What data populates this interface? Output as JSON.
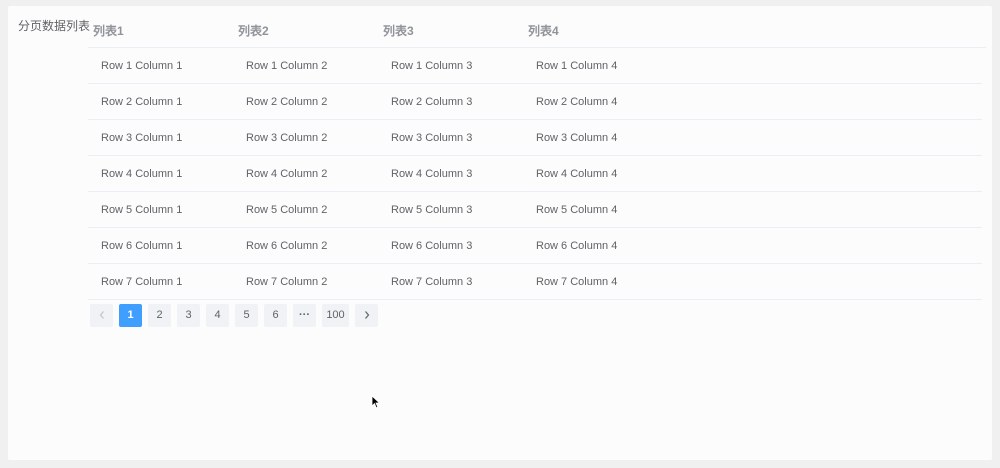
{
  "panel": {
    "label": "分页数据列表"
  },
  "table": {
    "headers": [
      "列表1",
      "列表2",
      "列表3",
      "列表4"
    ],
    "rows": [
      [
        "Row 1 Column 1",
        "Row 1 Column 2",
        "Row 1 Column 3",
        "Row 1 Column 4"
      ],
      [
        "Row 2 Column 1",
        "Row 2 Column 2",
        "Row 2 Column 3",
        "Row 2 Column 4"
      ],
      [
        "Row 3 Column 1",
        "Row 3 Column 2",
        "Row 3 Column 3",
        "Row 3 Column 4"
      ],
      [
        "Row 4 Column 1",
        "Row 4 Column 2",
        "Row 4 Column 3",
        "Row 4 Column 4"
      ],
      [
        "Row 5 Column 1",
        "Row 5 Column 2",
        "Row 5 Column 3",
        "Row 5 Column 4"
      ],
      [
        "Row 6 Column 1",
        "Row 6 Column 2",
        "Row 6 Column 3",
        "Row 6 Column 4"
      ],
      [
        "Row 7 Column 1",
        "Row 7 Column 2",
        "Row 7 Column 3",
        "Row 7 Column 4"
      ]
    ]
  },
  "pagination": {
    "prev_icon": "chevron-left-icon",
    "next_icon": "chevron-right-icon",
    "ellipsis": "···",
    "pages": [
      "1",
      "2",
      "3",
      "4",
      "5",
      "6"
    ],
    "last_page": "100",
    "current_page": "1"
  },
  "colors": {
    "accent": "#409eff",
    "page_background": "#f0f0f1",
    "card_background": "#fcfcfd"
  }
}
